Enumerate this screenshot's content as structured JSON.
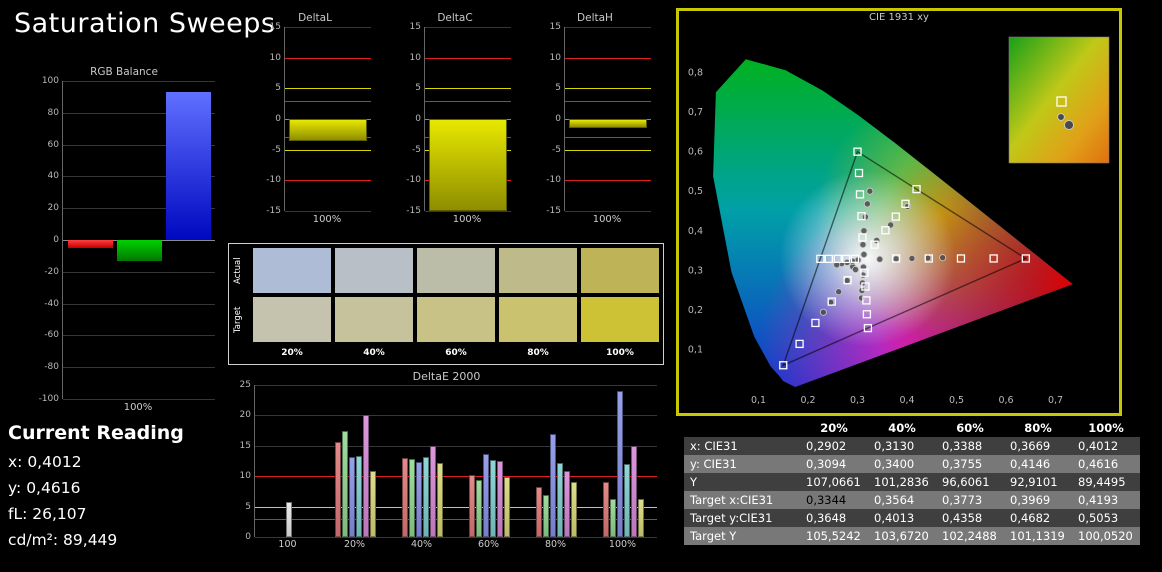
{
  "page": {
    "title": "Saturation Sweeps",
    "accent_border": "#c8c800"
  },
  "current_reading": {
    "heading": "Current Reading",
    "lines": [
      "x: 0,4012",
      "y: 0,4616",
      "fL: 26,107",
      "cd/m²: 89,449"
    ]
  },
  "swatches": {
    "row_labels": [
      "Actual",
      "Target"
    ],
    "col_labels": [
      "20%",
      "40%",
      "60%",
      "80%",
      "100%"
    ],
    "actual_colors": [
      "#aebcd6",
      "#b9bfc7",
      "#bcbda9",
      "#bfba8a",
      "#beb457"
    ],
    "target_colors": [
      "#c5c3ad",
      "#c6c29b",
      "#c8c287",
      "#cac26e",
      "#cdc136"
    ]
  },
  "results_table": {
    "columns": [
      "",
      "20%",
      "40%",
      "60%",
      "80%",
      "100%"
    ],
    "rows": [
      {
        "label": "x: CIE31",
        "values": [
          "0,2902",
          "0,3130",
          "0,3388",
          "0,3669",
          "0,4012"
        ]
      },
      {
        "label": "y: CIE31",
        "values": [
          "0,3094",
          "0,3400",
          "0,3755",
          "0,4146",
          "0,4616"
        ]
      },
      {
        "label": "Y",
        "values": [
          "107,0661",
          "101,2836",
          "96,6061",
          "92,9101",
          "89,4495"
        ]
      },
      {
        "label": "Target x:CIE31",
        "values": [
          "0,3344",
          "0,3564",
          "0,3773",
          "0,3969",
          "0,4193"
        ]
      },
      {
        "label": "Target y:CIE31",
        "values": [
          "0,3648",
          "0,4013",
          "0,4358",
          "0,4682",
          "0,5053"
        ]
      },
      {
        "label": "Target Y",
        "values": [
          "105,5242",
          "103,6720",
          "102,2488",
          "101,1319",
          "100,0520"
        ]
      }
    ],
    "highlight": {
      "row": 3,
      "col": 0
    }
  },
  "chart_data": [
    {
      "id": "rgb_balance",
      "type": "bar",
      "title": "RGB Balance",
      "xlabel": "100%",
      "categories": [
        "Red",
        "Green",
        "Blue"
      ],
      "values": [
        -5,
        -13,
        93
      ],
      "bar_colors": [
        "#c00000",
        "#007800",
        "#0008c0"
      ],
      "bar_colors_light": [
        "#ff4040",
        "#00d000",
        "#6070ff"
      ],
      "ylim": [
        -100,
        100
      ],
      "yticks": [
        100,
        80,
        60,
        40,
        20,
        0,
        -20,
        -40,
        -60,
        -80,
        -100
      ]
    },
    {
      "id": "delta_l",
      "type": "bar",
      "title": "DeltaL",
      "xlabel": "100%",
      "values": [
        -3.6
      ],
      "ylim": [
        -15,
        15
      ],
      "yticks": [
        15,
        10,
        5,
        0,
        -5,
        -10,
        -15
      ],
      "ref_lines": [
        {
          "v": 10,
          "color": "#e02020"
        },
        {
          "v": 5,
          "color": "#d8d800"
        },
        {
          "v": 3,
          "color": "#00a000"
        },
        {
          "v": -3,
          "color": "#00a000"
        },
        {
          "v": -5,
          "color": "#d8d800"
        },
        {
          "v": -10,
          "color": "#e02020"
        }
      ]
    },
    {
      "id": "delta_c",
      "type": "bar",
      "title": "DeltaC",
      "xlabel": "100%",
      "values": [
        -16.2
      ],
      "ylim": [
        -15,
        15
      ],
      "yticks": [
        15,
        10,
        5,
        0,
        -5,
        -10,
        -15
      ],
      "ref_lines": [
        {
          "v": 10,
          "color": "#e02020"
        },
        {
          "v": 5,
          "color": "#d8d800"
        },
        {
          "v": 3,
          "color": "#00a000"
        },
        {
          "v": -3,
          "color": "#00a000"
        },
        {
          "v": -5,
          "color": "#d8d800"
        },
        {
          "v": -10,
          "color": "#e02020"
        }
      ]
    },
    {
      "id": "delta_h",
      "type": "bar",
      "title": "DeltaH",
      "xlabel": "100%",
      "values": [
        -1.4
      ],
      "ylim": [
        -15,
        15
      ],
      "yticks": [
        15,
        10,
        5,
        0,
        -5,
        -10,
        -15
      ],
      "ref_lines": [
        {
          "v": 10,
          "color": "#e02020"
        },
        {
          "v": 5,
          "color": "#d8d800"
        },
        {
          "v": 3,
          "color": "#00a000"
        },
        {
          "v": -3,
          "color": "#00a000"
        },
        {
          "v": -5,
          "color": "#d8d800"
        },
        {
          "v": -10,
          "color": "#e02020"
        }
      ]
    },
    {
      "id": "deltae_2000",
      "type": "bar",
      "title": "DeltaE 2000",
      "categories": [
        "100",
        "20%",
        "40%",
        "60%",
        "80%",
        "100%"
      ],
      "series": [
        {
          "name": "red",
          "color": "#e07878",
          "values": [
            null,
            15.7,
            13.0,
            10.2,
            8.3,
            9.0
          ]
        },
        {
          "name": "green",
          "color": "#90d890",
          "values": [
            null,
            17.5,
            12.9,
            9.3,
            6.9,
            6.3
          ]
        },
        {
          "name": "blue",
          "color": "#8890e8",
          "values": [
            null,
            13.2,
            12.4,
            13.7,
            17.0,
            24.0
          ]
        },
        {
          "name": "cyan",
          "color": "#80d0d0",
          "values": [
            null,
            13.4,
            13.1,
            12.6,
            12.2,
            12.0
          ]
        },
        {
          "name": "magenta",
          "color": "#d888d8",
          "values": [
            null,
            20.0,
            14.9,
            12.5,
            10.9,
            15.0
          ]
        },
        {
          "name": "yellow",
          "color": "#d8d878",
          "values": [
            null,
            10.9,
            12.2,
            9.8,
            9.1,
            6.3
          ]
        },
        {
          "name": "white",
          "color": "#e8e8e8",
          "values": [
            5.8,
            null,
            null,
            null,
            null,
            null
          ]
        }
      ],
      "ylim": [
        0,
        25
      ],
      "yticks": [
        25,
        20,
        15,
        10,
        5,
        0
      ],
      "ref_lines": [
        {
          "v": 10,
          "color": "#e02020"
        },
        {
          "v": 5,
          "color": "#d8d800"
        },
        {
          "v": 3,
          "color": "#00a000"
        }
      ]
    },
    {
      "id": "cie1931",
      "type": "scatter",
      "title": "CIE 1931 xy",
      "xlim": [
        0,
        0.8
      ],
      "ylim": [
        0,
        0.9
      ],
      "xticks": [
        "0,1",
        "0,2",
        "0,3",
        "0,4",
        "0,5",
        "0,6",
        "0,7"
      ],
      "yticks": [
        "0,1",
        "0,2",
        "0,3",
        "0,4",
        "0,5",
        "0,6",
        "0,7",
        "0,8"
      ],
      "gamut_triangle": [
        [
          0.64,
          0.33
        ],
        [
          0.3,
          0.6
        ],
        [
          0.15,
          0.06
        ]
      ],
      "targets": [
        [
          0.378,
          0.33
        ],
        [
          0.444,
          0.33
        ],
        [
          0.509,
          0.33
        ],
        [
          0.575,
          0.33
        ],
        [
          0.64,
          0.33
        ],
        [
          0.31,
          0.383
        ],
        [
          0.308,
          0.437
        ],
        [
          0.305,
          0.492
        ],
        [
          0.303,
          0.546
        ],
        [
          0.3,
          0.6
        ],
        [
          0.28,
          0.275
        ],
        [
          0.248,
          0.221
        ],
        [
          0.215,
          0.167
        ],
        [
          0.183,
          0.114
        ],
        [
          0.15,
          0.06
        ],
        [
          0.295,
          0.329
        ],
        [
          0.277,
          0.329
        ],
        [
          0.26,
          0.329
        ],
        [
          0.242,
          0.329
        ],
        [
          0.225,
          0.329
        ],
        [
          0.314,
          0.294
        ],
        [
          0.316,
          0.259
        ],
        [
          0.318,
          0.224
        ],
        [
          0.319,
          0.189
        ],
        [
          0.321,
          0.154
        ],
        [
          0.3344,
          0.3648
        ],
        [
          0.3564,
          0.4013
        ],
        [
          0.3773,
          0.4358
        ],
        [
          0.3969,
          0.4682
        ],
        [
          0.4193,
          0.5053
        ]
      ],
      "measurements": [
        [
          0.2902,
          0.3094
        ],
        [
          0.313,
          0.34
        ],
        [
          0.3388,
          0.3755
        ],
        [
          0.3669,
          0.4146
        ],
        [
          0.4012,
          0.4616
        ],
        [
          0.345,
          0.328
        ],
        [
          0.378,
          0.329
        ],
        [
          0.41,
          0.33
        ],
        [
          0.442,
          0.331
        ],
        [
          0.472,
          0.332
        ],
        [
          0.311,
          0.365
        ],
        [
          0.313,
          0.4
        ],
        [
          0.316,
          0.435
        ],
        [
          0.32,
          0.468
        ],
        [
          0.325,
          0.5
        ],
        [
          0.296,
          0.302
        ],
        [
          0.279,
          0.274
        ],
        [
          0.262,
          0.246
        ],
        [
          0.246,
          0.219
        ],
        [
          0.231,
          0.194
        ],
        [
          0.301,
          0.326
        ],
        [
          0.29,
          0.323
        ],
        [
          0.279,
          0.32
        ],
        [
          0.268,
          0.317
        ],
        [
          0.258,
          0.314
        ],
        [
          0.312,
          0.308
        ],
        [
          0.311,
          0.288
        ],
        [
          0.31,
          0.268
        ],
        [
          0.309,
          0.249
        ],
        [
          0.308,
          0.23
        ]
      ],
      "inset": {
        "square": [
          0.4193,
          0.5053
        ],
        "circles": [
          [
            0.4012,
            0.4616
          ],
          [
            0.408,
            0.478
          ]
        ]
      }
    }
  ]
}
